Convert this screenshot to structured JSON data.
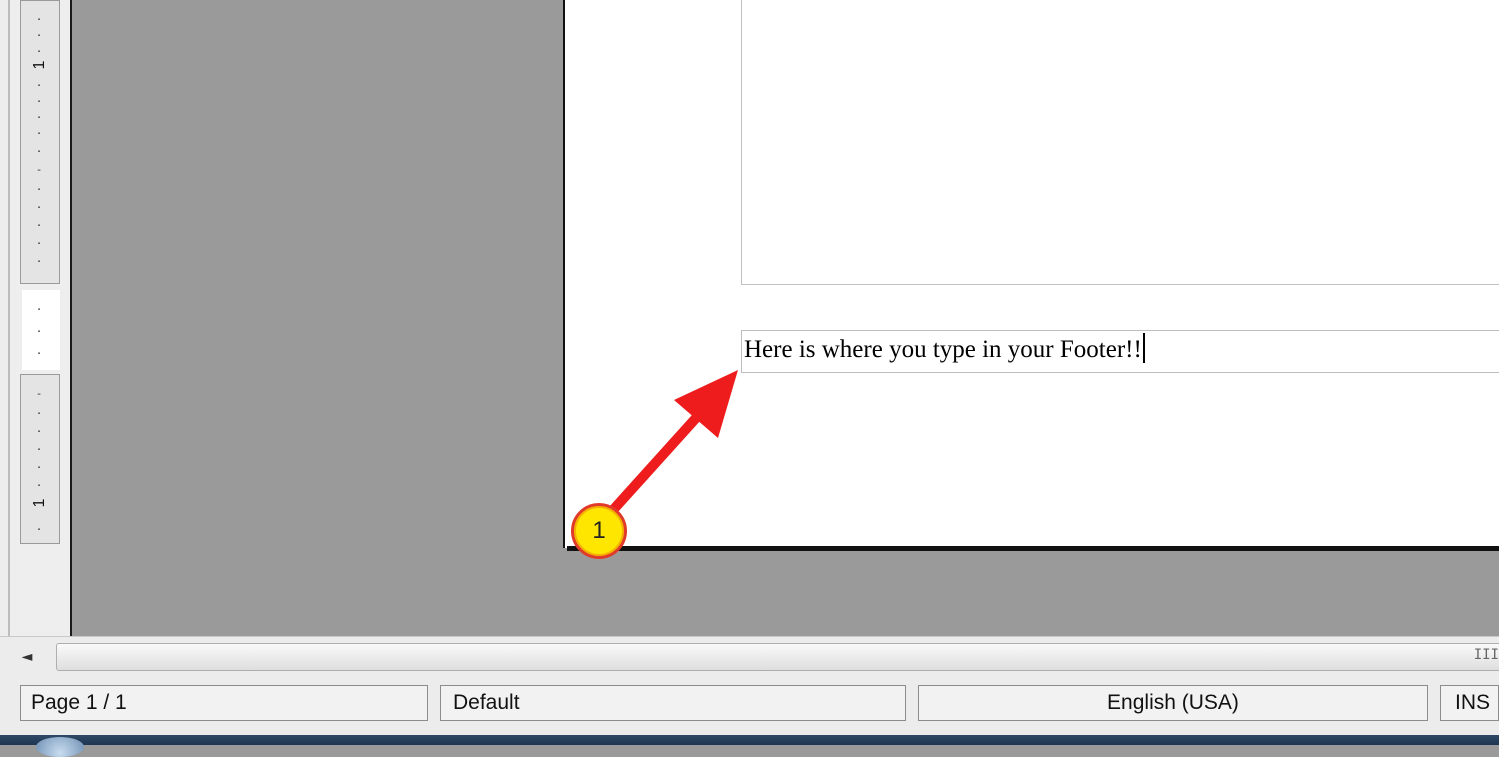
{
  "ruler": {
    "numbers": [
      "1",
      "1"
    ]
  },
  "document": {
    "footer_text": "Here is where you type in your Footer!!"
  },
  "annotation": {
    "callout_number": "1",
    "arrow_color": "#ee1c1c",
    "callout_color": "#ffe600"
  },
  "scrollbar": {
    "left_arrow": "◄",
    "grip": "III"
  },
  "statusbar": {
    "page": "Page 1 / 1",
    "style": "Default",
    "language": "English (USA)",
    "mode": "INS"
  }
}
